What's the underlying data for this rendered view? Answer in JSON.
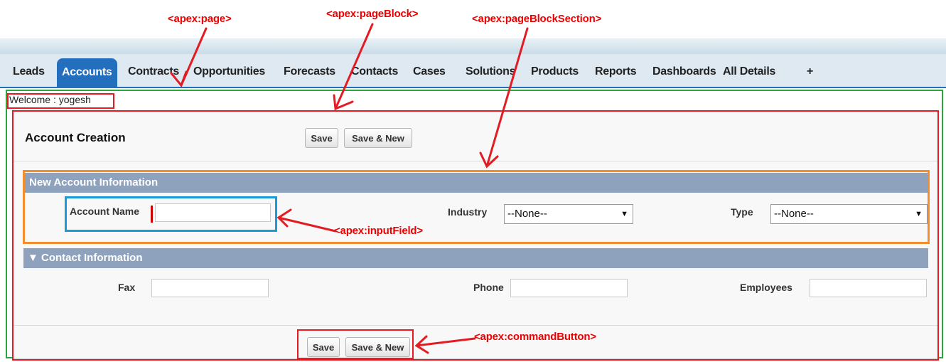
{
  "annotations": {
    "page": "<apex:page>",
    "pageBlock": "<apex:pageBlock>",
    "pageBlockSection": "<apex:pageBlockSection>",
    "inputField": "<apex:inputField>",
    "commandButton": "<apex:commandButton>",
    "color": "#e31b23"
  },
  "tabs": [
    {
      "label": "Leads",
      "active": false
    },
    {
      "label": "Accounts",
      "active": true
    },
    {
      "label": "Contracts",
      "active": false
    },
    {
      "label": "Opportunities",
      "active": false
    },
    {
      "label": "Forecasts",
      "active": false
    },
    {
      "label": "Contacts",
      "active": false
    },
    {
      "label": "Cases",
      "active": false
    },
    {
      "label": "Solutions",
      "active": false
    },
    {
      "label": "Products",
      "active": false
    },
    {
      "label": "Reports",
      "active": false
    },
    {
      "label": "Dashboards",
      "active": false
    },
    {
      "label": "All Details",
      "active": false
    },
    {
      "label": "+",
      "active": false
    }
  ],
  "welcome": "Welcome : yogesh",
  "page_block": {
    "title": "Account Creation",
    "save_label": "Save",
    "save_new_label": "Save & New"
  },
  "sections": {
    "new_account": {
      "title": "New Account Information",
      "account_name_label": "Account Name",
      "account_name_value": "",
      "industry_label": "Industry",
      "industry_value": "--None--",
      "type_label": "Type",
      "type_value": "--None--"
    },
    "contact": {
      "title": "▼ Contact Information",
      "fax_label": "Fax",
      "phone_label": "Phone",
      "employees_label": "Employees"
    }
  },
  "colors": {
    "tab_active": "#236fbd",
    "section_header": "#8ea2bd",
    "page_outline": "#28a83a",
    "section_outline": "#f28e2c",
    "input_outline": "#1a9ad6"
  }
}
